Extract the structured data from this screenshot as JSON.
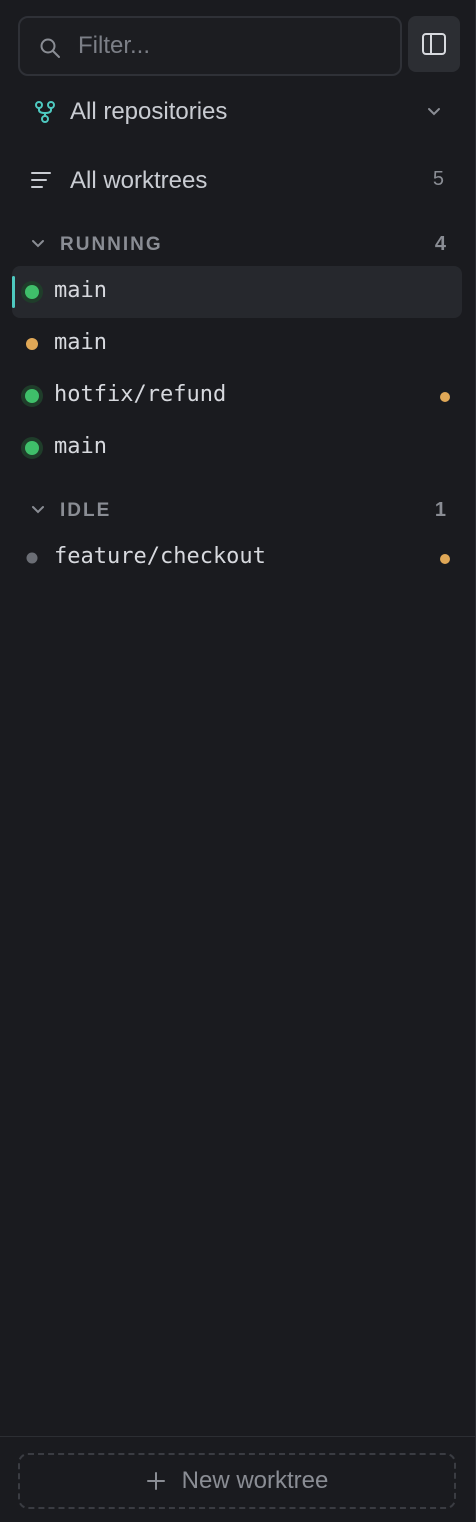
{
  "search": {
    "placeholder": "Filter...",
    "value": ""
  },
  "repo_filter": {
    "label": "All repositories"
  },
  "all_worktrees": {
    "label": "All worktrees",
    "count": "5"
  },
  "sections": {
    "running": {
      "title": "RUNNING",
      "count": "4",
      "items": [
        {
          "name": "main",
          "status": "running",
          "active": true,
          "dirty": false
        },
        {
          "name": "main",
          "status": "pending",
          "active": false,
          "dirty": false
        },
        {
          "name": "hotfix/refund",
          "status": "running",
          "active": false,
          "dirty": true
        },
        {
          "name": "main",
          "status": "running",
          "active": false,
          "dirty": false
        }
      ]
    },
    "idle": {
      "title": "IDLE",
      "count": "1",
      "items": [
        {
          "name": "feature/checkout",
          "status": "idle",
          "active": false,
          "dirty": true
        }
      ]
    }
  },
  "footer": {
    "new_label": "New worktree"
  },
  "colors": {
    "accent": "#4ec9c0",
    "running": "#3fbf6a",
    "pending": "#e0a857",
    "idle": "#6b6e75",
    "background": "#1a1b1f"
  }
}
